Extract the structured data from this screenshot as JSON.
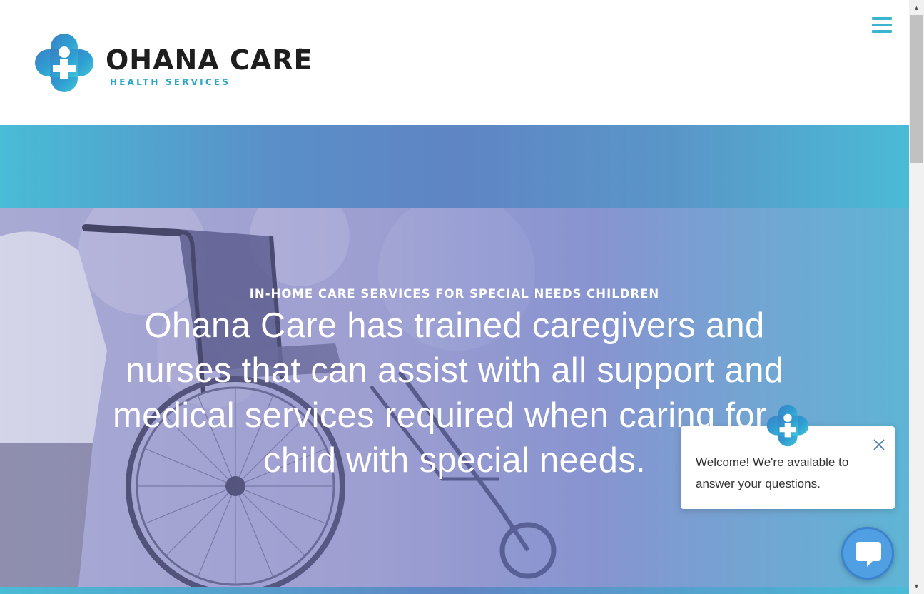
{
  "header": {
    "logo": {
      "name": "OHANA CARE",
      "trademark": "™",
      "subtitle": "HEALTH SERVICES",
      "icon": "ohana-care-cross-logo"
    },
    "menu_icon": "hamburger-menu-icon"
  },
  "hero": {
    "eyebrow": "IN-HOME CARE SERVICES FOR SPECIAL NEEDS CHILDREN",
    "headline": "Ohana Care has trained caregivers and nurses that can assist with all support and medical services required when caring for a child with special needs."
  },
  "chat": {
    "message": "Welcome! We're available to answer your questions.",
    "close_icon": "close-icon",
    "launcher_icon": "chat-bubble-icon",
    "avatar_icon": "ohana-care-cross-logo"
  },
  "scrollbar": {
    "up_glyph": "▲",
    "down_glyph": "▼"
  },
  "colors": {
    "accent": "#3bb5cf",
    "brand_blue": "#2aa5c9",
    "chat_launcher": "#4f9fe2",
    "text_dark": "#1e1e1e"
  }
}
